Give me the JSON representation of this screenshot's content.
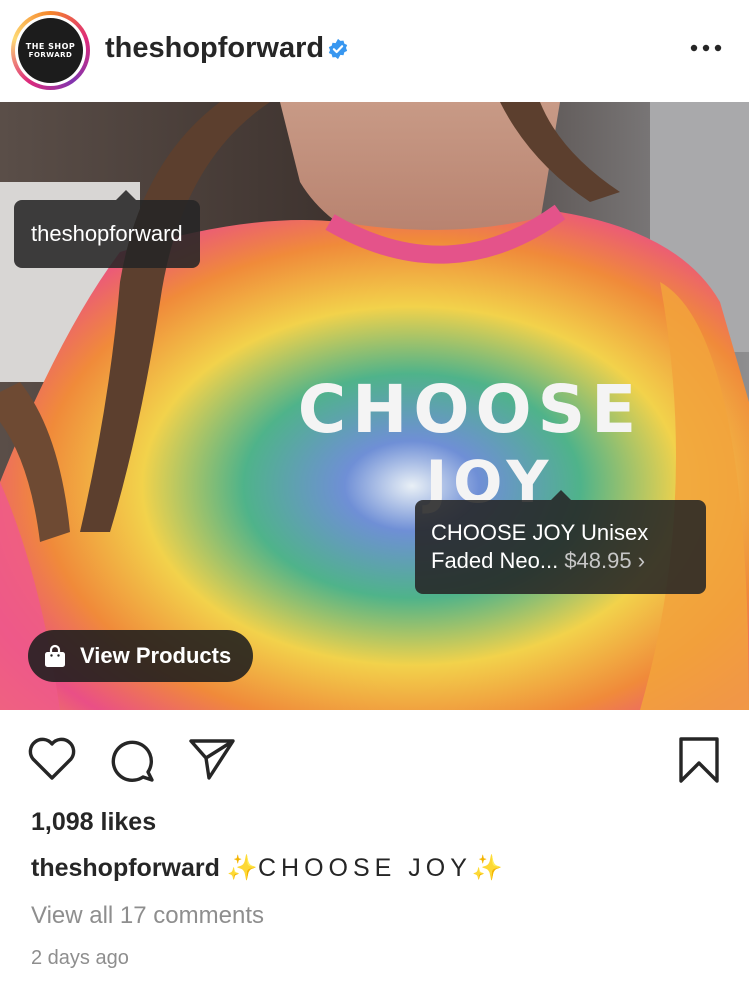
{
  "header": {
    "username": "theshopforward",
    "avatar": {
      "line1": "THE SHOP",
      "line2": "FORWARD"
    },
    "verified_icon": "verified-badge-icon",
    "more_icon": "more-options-icon"
  },
  "post": {
    "tags": {
      "user_tag": "theshopforward",
      "product_name": "CHOOSE JOY Unisex Faded Neo...",
      "product_name_line1": "CHOOSE JOY Unisex",
      "product_name_line2": "Faded Neo...",
      "product_price": "$48.95",
      "chevron": "›"
    },
    "view_products_label": "View Products",
    "shirt_text_1": "CHOOSE",
    "shirt_text_2": "JOY"
  },
  "actions": {
    "like_icon": "heart-icon",
    "comment_icon": "comment-icon",
    "share_icon": "share-icon",
    "save_icon": "bookmark-icon"
  },
  "likes": "1,098 likes",
  "caption": {
    "username": "theshopforward",
    "sparkle": "✨",
    "text": "CHOOSE JOY"
  },
  "comments_link": "View all 17 comments",
  "timestamp": "2 days ago",
  "colors": {
    "text": "#262626",
    "muted": "#8e8e8e",
    "verified": "#3897f0"
  }
}
